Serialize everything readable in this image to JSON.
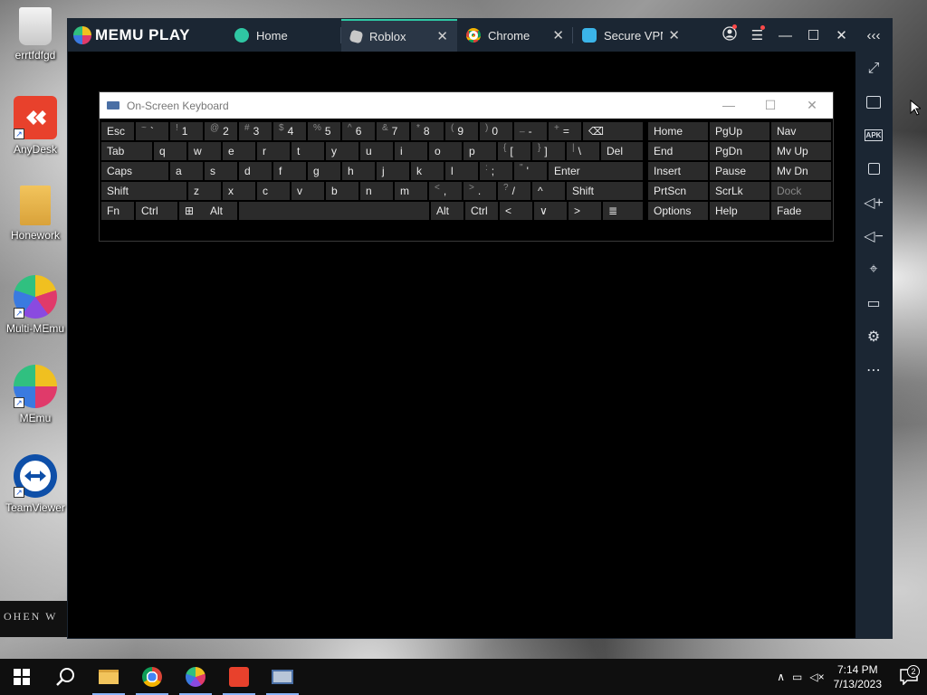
{
  "desktop": {
    "icons": [
      {
        "label": "errtfdfgd"
      },
      {
        "label": "AnyDesk"
      },
      {
        "label": "Honework"
      },
      {
        "label": "Multi-MEmu"
      },
      {
        "label": "MEmu"
      },
      {
        "label": "TeamViewer"
      }
    ],
    "watermark_text": "OHEN W"
  },
  "memu": {
    "logo": "MEMU PLAY",
    "tabs": [
      {
        "label": "Home",
        "icon": "home-tab-icon"
      },
      {
        "label": "Roblox",
        "icon": "roblox-icon",
        "active": true
      },
      {
        "label": "Chrome",
        "icon": "chrome-icon"
      },
      {
        "label": "Secure VPN",
        "icon": "vpn-icon"
      }
    ],
    "controls": {
      "account": "account-icon",
      "menu": "menu-icon",
      "minimize": "—",
      "maximize": "☐",
      "close": "✕",
      "collapse": "‹‹‹"
    },
    "sidebar": [
      "fullscreen-icon",
      "keyboard-icon",
      "apk-icon",
      "multi-window-icon",
      "volume-up-icon",
      "volume-down-icon",
      "location-icon",
      "folder-icon",
      "settings-icon",
      "more-icon"
    ],
    "apk_label": "APK"
  },
  "osk": {
    "title": "On-Screen Keyboard",
    "row1": [
      {
        "main": "Esc"
      },
      {
        "shift": "~",
        "main": "`"
      },
      {
        "shift": "!",
        "main": "1"
      },
      {
        "shift": "@",
        "main": "2"
      },
      {
        "shift": "#",
        "main": "3"
      },
      {
        "shift": "$",
        "main": "4"
      },
      {
        "shift": "%",
        "main": "5"
      },
      {
        "shift": "^",
        "main": "6"
      },
      {
        "shift": "&",
        "main": "7"
      },
      {
        "shift": "*",
        "main": "8"
      },
      {
        "shift": "(",
        "main": "9"
      },
      {
        "shift": ")",
        "main": "0"
      },
      {
        "shift": "_",
        "main": "-"
      },
      {
        "shift": "+",
        "main": "="
      },
      {
        "main": "⌫"
      }
    ],
    "row2": [
      {
        "main": "Tab"
      },
      {
        "main": "q"
      },
      {
        "main": "w"
      },
      {
        "main": "e"
      },
      {
        "main": "r"
      },
      {
        "main": "t"
      },
      {
        "main": "y"
      },
      {
        "main": "u"
      },
      {
        "main": "i"
      },
      {
        "main": "o"
      },
      {
        "main": "p"
      },
      {
        "shift": "{",
        "main": "["
      },
      {
        "shift": "}",
        "main": "]"
      },
      {
        "shift": "|",
        "main": "\\"
      },
      {
        "main": "Del"
      }
    ],
    "row3": [
      {
        "main": "Caps"
      },
      {
        "main": "a"
      },
      {
        "main": "s"
      },
      {
        "main": "d"
      },
      {
        "main": "f"
      },
      {
        "main": "g"
      },
      {
        "main": "h"
      },
      {
        "main": "j"
      },
      {
        "main": "k"
      },
      {
        "main": "l"
      },
      {
        "shift": ":",
        "main": ";"
      },
      {
        "shift": "\"",
        "main": "'"
      },
      {
        "main": "Enter"
      }
    ],
    "row4": [
      {
        "main": "Shift"
      },
      {
        "main": "z"
      },
      {
        "main": "x"
      },
      {
        "main": "c"
      },
      {
        "main": "v"
      },
      {
        "main": "b"
      },
      {
        "main": "n"
      },
      {
        "main": "m"
      },
      {
        "shift": "<",
        "main": ","
      },
      {
        "shift": ">",
        "main": "."
      },
      {
        "shift": "?",
        "main": "/"
      },
      {
        "main": "^"
      },
      {
        "main": "Shift"
      }
    ],
    "row5": [
      {
        "main": "Fn"
      },
      {
        "main": "Ctrl"
      },
      {
        "main": "⊞"
      },
      {
        "main": "Alt"
      },
      {
        "main": ""
      },
      {
        "main": "Alt"
      },
      {
        "main": "Ctrl"
      },
      {
        "main": "<"
      },
      {
        "main": "∨"
      },
      {
        "main": ">"
      },
      {
        "main": "≣"
      }
    ],
    "nav": [
      [
        "Home",
        "PgUp",
        "Nav"
      ],
      [
        "End",
        "PgDn",
        "Mv Up"
      ],
      [
        "Insert",
        "Pause",
        "Mv Dn"
      ],
      [
        "PrtScn",
        "ScrLk",
        "Dock"
      ],
      [
        "Options",
        "Help",
        "Fade"
      ]
    ]
  },
  "taskbar": {
    "apps": [
      "start-icon",
      "search-icon",
      "file-explorer-icon",
      "chrome-icon",
      "multi-memu-icon",
      "anydesk-icon",
      "osk-icon"
    ],
    "time": "7:14 PM",
    "date": "7/13/2023",
    "notifications": "2"
  },
  "colors": {
    "memu_bar": "#1b2633",
    "active_tab_accent": "#2fc6a3",
    "key_bg": "#2b2b2b"
  }
}
